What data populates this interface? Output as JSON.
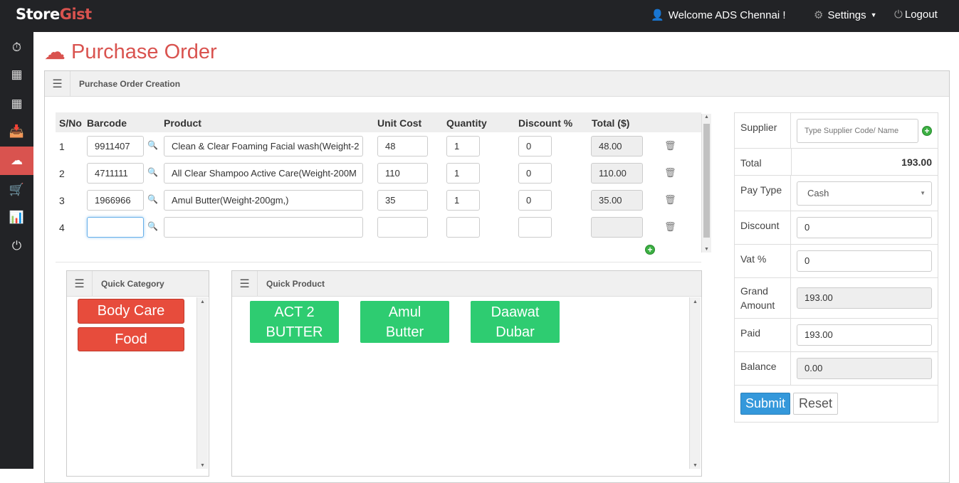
{
  "app": {
    "logo_a": "Store",
    "logo_b": "Gist",
    "brand_color": "#d9534f"
  },
  "topbar": {
    "welcome": "Welcome ADS Chennai !",
    "settings": "Settings",
    "logout": "Logout"
  },
  "sidebar": {
    "items": [
      {
        "icon": "dashboard-icon"
      },
      {
        "icon": "table-icon"
      },
      {
        "icon": "table-icon"
      },
      {
        "icon": "inbox-icon"
      },
      {
        "icon": "cloud-download-icon",
        "active": true
      },
      {
        "icon": "cart-icon"
      },
      {
        "icon": "bar-chart-icon"
      },
      {
        "icon": "power-icon"
      }
    ]
  },
  "page": {
    "title": "Purchase Order",
    "panel_title": "Purchase Order Creation"
  },
  "table": {
    "headers": [
      "S/No",
      "Barcode",
      "Product",
      "Unit Cost",
      "Quantity",
      "Discount %",
      "Total ($)"
    ],
    "rows": [
      {
        "sno": "1",
        "barcode": "9911407",
        "product": "Clean & Clear Foaming Facial wash(Weight-2",
        "unit_cost": "48",
        "quantity": "1",
        "discount": "0",
        "total": "48.00"
      },
      {
        "sno": "2",
        "barcode": "4711111",
        "product": "All Clear Shampoo Active Care(Weight-200M",
        "unit_cost": "110",
        "quantity": "1",
        "discount": "0",
        "total": "110.00"
      },
      {
        "sno": "3",
        "barcode": "1966966",
        "product": "Amul Butter(Weight-200gm,)",
        "unit_cost": "35",
        "quantity": "1",
        "discount": "0",
        "total": "35.00"
      },
      {
        "sno": "4",
        "barcode": "",
        "product": "",
        "unit_cost": "",
        "quantity": "",
        "discount": "",
        "total": ""
      }
    ]
  },
  "quick_category": {
    "title": "Quick Category",
    "items": [
      "Body Care",
      "Food"
    ],
    "color": "#e74c3c"
  },
  "quick_product": {
    "title": "Quick Product",
    "items": [
      [
        "ACT 2",
        "BUTTER"
      ],
      [
        "Amul",
        "Butter"
      ],
      [
        "Daawat",
        "Dubar"
      ]
    ],
    "color": "#2ecc71"
  },
  "summary": {
    "supplier_label": "Supplier",
    "supplier_placeholder": "Type Supplier Code/ Name",
    "total_label": "Total",
    "total": "193.00",
    "pay_type_label": "Pay Type",
    "pay_type": "Cash",
    "discount_label": "Discount",
    "discount": "0",
    "vat_label": "Vat %",
    "vat": "0",
    "grand_label_1": "Grand",
    "grand_label_2": "Amount",
    "grand": "193.00",
    "paid_label": "Paid",
    "paid": "193.00",
    "balance_label": "Balance",
    "balance": "0.00",
    "submit": "Submit",
    "reset": "Reset"
  }
}
